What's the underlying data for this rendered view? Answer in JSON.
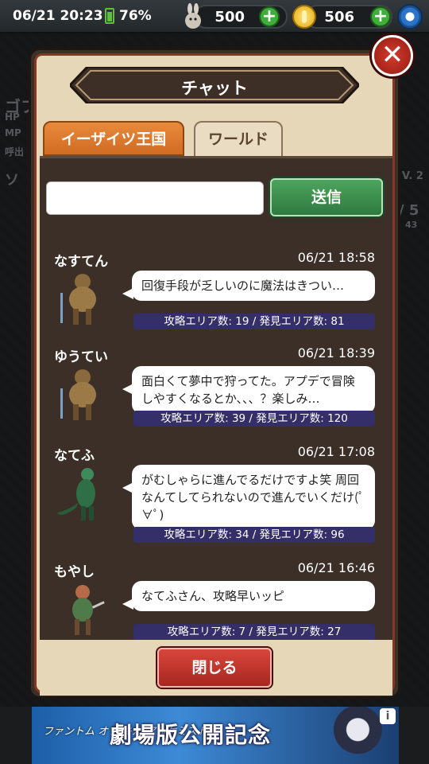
{
  "status": {
    "time": "06/21 20:23",
    "battery": "76%"
  },
  "resources": {
    "stamina": {
      "icon": "rabbit-icon",
      "value": "500"
    },
    "coins": {
      "icon": "coin-icon",
      "value": "506"
    },
    "add_label": "+"
  },
  "background": {
    "left_label_1": "ゴフ",
    "hp": "HP",
    "mp": "MP",
    "call": "呼出",
    "side": "ソ",
    "level": "V. 2",
    "count": "/ 5",
    "time_partial": "43"
  },
  "modal": {
    "title": "チャット",
    "close_glyph": "✕",
    "tabs": [
      {
        "label": "イーザイツ王国",
        "active": false
      },
      {
        "label": "ワールド",
        "active": true
      }
    ],
    "input": {
      "value": "",
      "placeholder": ""
    },
    "send_label": "送信",
    "close_button_label": "閉じる"
  },
  "messages": [
    {
      "user": "なすてん",
      "date": "06/21 18:58",
      "text": "回復手段が乏しいのに魔法はきつい…",
      "stats": "攻略エリア数: 19 / 発見エリア数: 81",
      "avatar": "beast-warrior-icon"
    },
    {
      "user": "ゆうてい",
      "date": "06/21 18:39",
      "text": "面白くて夢中で狩ってた。アプデで冒険しやすくなるとか、、、？楽しみ…",
      "stats": "攻略エリア数: 39 / 発見エリア数: 120",
      "avatar": "beast-warrior-icon"
    },
    {
      "user": "なてふ",
      "date": "06/21 17:08",
      "text": "がむしゃらに進んでるだけですよ笑 周回なんてしてられないので進んでいくだけ(ﾟ∀ﾟ)",
      "stats": "攻略エリア数: 34 / 発見エリア数: 96",
      "avatar": "lizardman-icon"
    },
    {
      "user": "もやし",
      "date": "06/21 16:46",
      "text": "なてふさん、攻略早いッピ",
      "stats": "攻略エリア数: 7 / 発見エリア数: 27",
      "avatar": "goblin-icon"
    }
  ],
  "ad": {
    "logo": "ファントム オブ キル アルケミスト",
    "title": "劇場版公開記念",
    "info": "i"
  },
  "colors": {
    "accent_green": "#3fae3a",
    "close_red": "#c7352a",
    "stats_bar": "#342e69",
    "tab_orange": "#e07a2e"
  }
}
